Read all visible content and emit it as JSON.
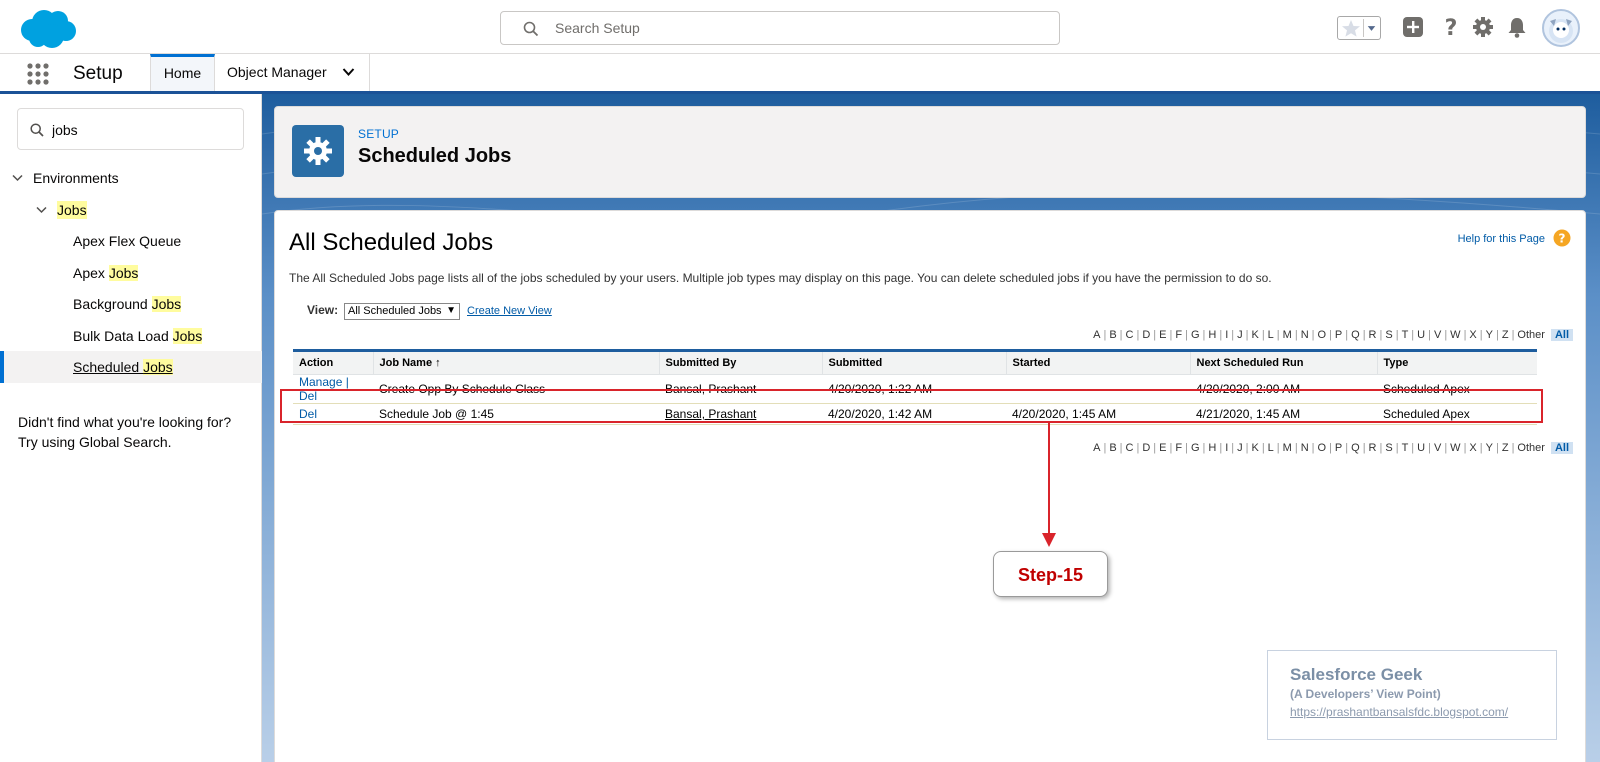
{
  "header": {
    "search_placeholder": "Search Setup",
    "icons": [
      "cloud-logo",
      "search-icon",
      "favorites-star-icon",
      "favorites-caret-icon",
      "add-icon",
      "help-icon",
      "gear-icon",
      "bell-icon",
      "avatar"
    ]
  },
  "nav": {
    "app_name": "Setup",
    "tabs": [
      {
        "label": "Home",
        "active": true
      },
      {
        "label": "Object Manager",
        "active": false
      }
    ]
  },
  "sidebar": {
    "quick_find_value": "jobs",
    "tree": {
      "environments": "Environments",
      "jobs_folder": "Jobs",
      "items": [
        {
          "pre": "Apex Flex Queue",
          "hl": ""
        },
        {
          "pre": "Apex ",
          "hl": "Jobs"
        },
        {
          "pre": "Background ",
          "hl": "Jobs"
        },
        {
          "pre": "Bulk Data Load ",
          "hl": "Jobs"
        },
        {
          "pre": "Scheduled ",
          "hl": "Jobs"
        }
      ]
    },
    "not_found_line1": "Didn't find what you're looking for?",
    "not_found_line2": "Try using Global Search."
  },
  "page_header": {
    "eyebrow": "SETUP",
    "title": "Scheduled Jobs"
  },
  "content": {
    "title": "All Scheduled Jobs",
    "help_link": "Help for this Page",
    "description": "The All Scheduled Jobs page lists all of the jobs scheduled by your users. Multiple job types may display on this page. You can delete scheduled jobs if you have the permission to do so.",
    "view_label": "View:",
    "view_selected": "All Scheduled Jobs",
    "create_new_view": "Create New View",
    "alphabet": [
      "A",
      "B",
      "C",
      "D",
      "E",
      "F",
      "G",
      "H",
      "I",
      "J",
      "K",
      "L",
      "M",
      "N",
      "O",
      "P",
      "Q",
      "R",
      "S",
      "T",
      "U",
      "V",
      "W",
      "X",
      "Y",
      "Z",
      "Other"
    ],
    "alphabet_all": "All",
    "table": {
      "columns": [
        "Action",
        "Job Name ↑",
        "Submitted By",
        "Submitted",
        "Started",
        "Next Scheduled Run",
        "Type"
      ],
      "rows": [
        {
          "action_manage": "Manage",
          "action_sep": " | ",
          "action_del": "Del",
          "job_name": "Create Opp By Schedule Class",
          "submitted_by": "Bansal, Prashant",
          "submitted": "4/20/2020, 1:22 AM",
          "started": "",
          "next_run": "4/20/2020, 2:00 AM",
          "type": "Scheduled Apex"
        },
        {
          "action_manage": "",
          "action_sep": "",
          "action_del": "Del",
          "job_name": "Schedule Job @ 1:45",
          "submitted_by": "Bansal, Prashant",
          "submitted": "4/20/2020, 1:42 AM",
          "started": "4/20/2020, 1:45 AM",
          "next_run": "4/21/2020, 1:45 AM",
          "type": "Scheduled Apex"
        }
      ]
    }
  },
  "annotation": {
    "step_label": "Step-15",
    "color": "#d9242b"
  },
  "watermark": {
    "title": "Salesforce Geek",
    "subtitle": "(A Developers’ View Point)",
    "url": "https://prashantbansalsfdc.blogspot.com/"
  },
  "colors": {
    "brand_blue": "#0070d2",
    "salesforce_cloud": "#00a1e0",
    "header_band": "#1e5d9e",
    "highlight_yellow": "#fffc9e"
  }
}
